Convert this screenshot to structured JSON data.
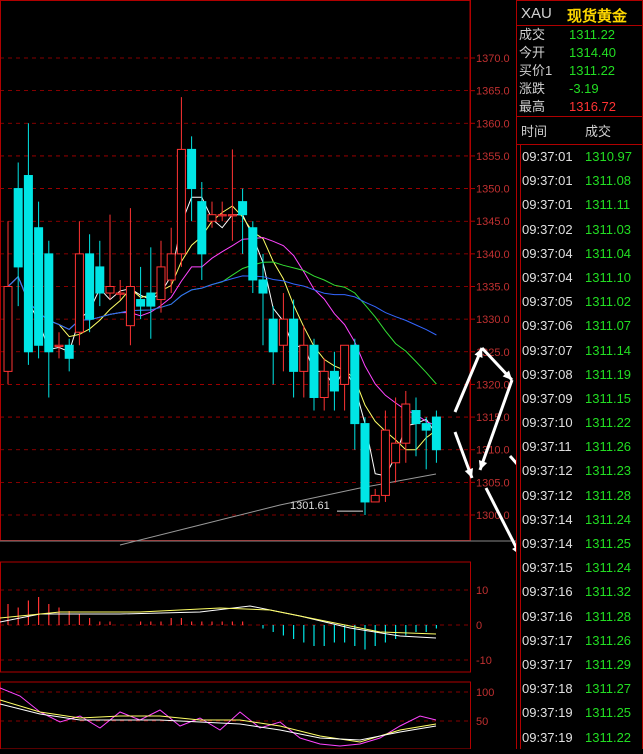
{
  "header": {
    "symbol": "XAU",
    "name": "现货黄金"
  },
  "quote": [
    {
      "label": "成交",
      "value": "1311.22",
      "color": "#22dd22"
    },
    {
      "label": "今开",
      "value": "1314.40",
      "color": "#22dd22"
    },
    {
      "label": "买价1",
      "value": "1311.22",
      "color": "#22dd22"
    },
    {
      "label": "涨跌",
      "value": "-3.19",
      "color": "#22dd22"
    },
    {
      "label": "最高",
      "value": "1316.72",
      "color": "#ff3333"
    }
  ],
  "ticks_header": {
    "time": "时间",
    "price": "成交"
  },
  "ticks": [
    {
      "time": "09:37:01",
      "price": "1310.97"
    },
    {
      "time": "09:37:01",
      "price": "1311.08"
    },
    {
      "time": "09:37:01",
      "price": "1311.11"
    },
    {
      "time": "09:37:02",
      "price": "1311.03"
    },
    {
      "time": "09:37:04",
      "price": "1311.04"
    },
    {
      "time": "09:37:04",
      "price": "1311.10"
    },
    {
      "time": "09:37:05",
      "price": "1311.02"
    },
    {
      "time": "09:37:06",
      "price": "1311.07"
    },
    {
      "time": "09:37:07",
      "price": "1311.14"
    },
    {
      "time": "09:37:08",
      "price": "1311.19"
    },
    {
      "time": "09:37:09",
      "price": "1311.15"
    },
    {
      "time": "09:37:10",
      "price": "1311.22"
    },
    {
      "time": "09:37:11",
      "price": "1311.26"
    },
    {
      "time": "09:37:12",
      "price": "1311.23"
    },
    {
      "time": "09:37:12",
      "price": "1311.28"
    },
    {
      "time": "09:37:14",
      "price": "1311.24"
    },
    {
      "time": "09:37:14",
      "price": "1311.25"
    },
    {
      "time": "09:37:15",
      "price": "1311.24"
    },
    {
      "time": "09:37:16",
      "price": "1311.32"
    },
    {
      "time": "09:37:16",
      "price": "1311.28"
    },
    {
      "time": "09:37:17",
      "price": "1311.26"
    },
    {
      "time": "09:37:17",
      "price": "1311.29"
    },
    {
      "time": "09:37:18",
      "price": "1311.27"
    },
    {
      "time": "09:37:19",
      "price": "1311.25"
    },
    {
      "time": "09:37:19",
      "price": "1311.22"
    }
  ],
  "main_axis": [
    "1370.0",
    "1365.0",
    "1360.0",
    "1355.0",
    "1350.0",
    "1345.0",
    "1340.0",
    "1335.0",
    "1330.0",
    "1325.0",
    "1320.0",
    "1315.0",
    "1310.0",
    "1305.0",
    "1300.0"
  ],
  "low_marker": "1301.61",
  "macd_axis": [
    "10",
    "0",
    "-10"
  ],
  "kdj_axis": [
    "100",
    "50"
  ],
  "colors": {
    "up": "#ff3333",
    "down": "#00e5e5",
    "grid": "#b00000",
    "ma5": "#ffffff",
    "ma10": "#ffff66",
    "ma20": "#ff44ff",
    "ma30": "#33dd33",
    "ma60": "#3366ff"
  },
  "chart_data": {
    "type": "candlestick",
    "ylim": [
      1297,
      1372
    ],
    "candles": [
      [
        1322,
        1335,
        1320,
        1345
      ],
      [
        1350,
        1338,
        1332,
        1354
      ],
      [
        1352,
        1325,
        1323,
        1360
      ],
      [
        1344,
        1326,
        1324,
        1348
      ],
      [
        1340,
        1325,
        1318,
        1342
      ],
      [
        1326,
        1326,
        1324,
        1328
      ],
      [
        1326,
        1324,
        1322,
        1327
      ],
      [
        1328,
        1340,
        1326,
        1345
      ],
      [
        1340,
        1330,
        1328,
        1343
      ],
      [
        1338,
        1334,
        1332,
        1342
      ],
      [
        1334,
        1335,
        1333,
        1346
      ],
      [
        1334,
        1334,
        1333,
        1336
      ],
      [
        1329,
        1335,
        1326,
        1347
      ],
      [
        1333,
        1332,
        1330,
        1338
      ],
      [
        1334,
        1332,
        1327,
        1341
      ],
      [
        1333,
        1338,
        1331,
        1342
      ],
      [
        1336,
        1340,
        1334,
        1344
      ],
      [
        1340,
        1356,
        1338,
        1364
      ],
      [
        1356,
        1350,
        1345,
        1358
      ],
      [
        1348,
        1340,
        1336,
        1351
      ],
      [
        1345,
        1346,
        1344,
        1348
      ],
      [
        1346,
        1346,
        1345,
        1348
      ],
      [
        1346,
        1346,
        1342,
        1356
      ],
      [
        1348,
        1346,
        1340,
        1350
      ],
      [
        1344,
        1336,
        1334,
        1345
      ],
      [
        1336,
        1334,
        1326,
        1340
      ],
      [
        1330,
        1325,
        1320,
        1332
      ],
      [
        1326,
        1330,
        1322,
        1334
      ],
      [
        1330,
        1322,
        1318,
        1333
      ],
      [
        1322,
        1326,
        1318,
        1329
      ],
      [
        1326,
        1318,
        1316,
        1327
      ],
      [
        1318,
        1322,
        1316,
        1324
      ],
      [
        1322,
        1319,
        1316,
        1325
      ],
      [
        1320,
        1326,
        1316,
        1326
      ],
      [
        1326,
        1314,
        1310,
        1327
      ],
      [
        1314,
        1302,
        1300,
        1315
      ],
      [
        1302,
        1303,
        1302,
        1304
      ],
      [
        1303,
        1313,
        1302,
        1316
      ],
      [
        1308,
        1311,
        1305,
        1318
      ],
      [
        1311,
        1317,
        1308,
        1319
      ],
      [
        1316,
        1314,
        1309,
        1318
      ],
      [
        1314,
        1313,
        1307,
        1315
      ],
      [
        1315,
        1310,
        1308,
        1316
      ]
    ]
  }
}
